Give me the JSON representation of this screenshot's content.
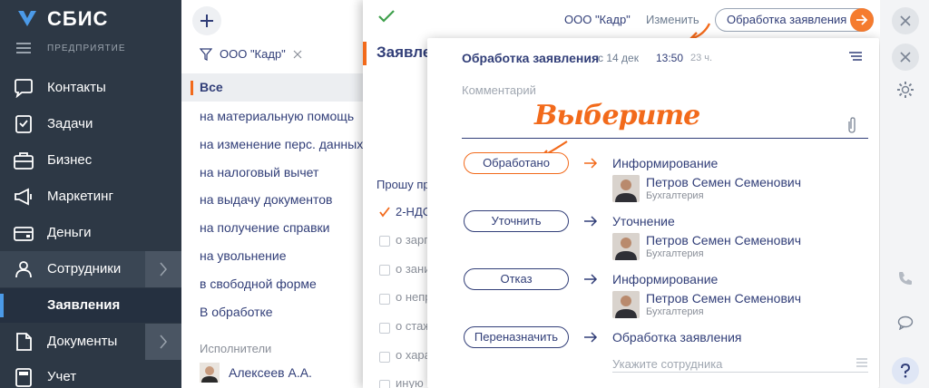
{
  "sidebar": {
    "brand": "СБИС",
    "section": "ПРЕДПРИЯТИЕ",
    "items": [
      {
        "label": "Контакты",
        "icon": "contacts-icon"
      },
      {
        "label": "Задачи",
        "icon": "tasks-icon"
      },
      {
        "label": "Бизнес",
        "icon": "business-icon"
      },
      {
        "label": "Маркетинг",
        "icon": "marketing-icon"
      },
      {
        "label": "Деньги",
        "icon": "money-icon"
      },
      {
        "label": "Сотрудники",
        "icon": "employees-icon"
      },
      {
        "label": "Документы",
        "icon": "documents-icon"
      },
      {
        "label": "Учет",
        "icon": "accounting-icon"
      }
    ],
    "active_sub": "Заявления"
  },
  "filter_panel": {
    "filter_value": "ООО \"Кадр\"",
    "items": [
      "Все",
      "на материальную помощь",
      "на изменение перс. данных",
      "на налоговый вычет",
      "на выдачу документов",
      "на получение справки",
      "на увольнение",
      "в свободной форме",
      "В обработке"
    ],
    "executors_title": "Исполнители",
    "executor": "Алексеев А.А."
  },
  "document": {
    "org": "ООО \"Кадр\"",
    "edit_label": "Изменить",
    "stage_button": "Обработка заявления",
    "title": "Заявле",
    "prompt": "Прошу пр",
    "options": [
      {
        "label": "2-НДС",
        "checked": true
      },
      {
        "label": "о зарп",
        "checked": false
      },
      {
        "label": "о зани",
        "checked": false
      },
      {
        "label": "о непр",
        "checked": false
      },
      {
        "label": "о стаж",
        "checked": false
      },
      {
        "label": "о хара",
        "checked": false
      },
      {
        "label": "иную",
        "checked": false
      }
    ]
  },
  "popup": {
    "title": "Обработка заявления",
    "date": "с 14 дек",
    "time": "13:50",
    "ago": "23 ч.",
    "comment_placeholder": "Комментарий",
    "handwritten": "Выберите",
    "actions": [
      {
        "label": "Обработано",
        "next": "Информирование",
        "person": "Петров Семен Семенович",
        "dept": "Бухгалтерия",
        "highlight": true
      },
      {
        "label": "Уточнить",
        "next": "Уточнение",
        "person": "Петров Семен Семенович",
        "dept": "Бухгалтерия",
        "highlight": false
      },
      {
        "label": "Отказ",
        "next": "Информирование",
        "person": "Петров Семен Семенович",
        "dept": "Бухгалтерия",
        "highlight": false
      },
      {
        "label": "Переназначить",
        "next": "Обработка заявления",
        "person": "",
        "dept": "",
        "highlight": false
      }
    ],
    "employee_placeholder": "Укажите сотрудника"
  },
  "colors": {
    "accent": "#f26a1b",
    "text": "#313e78",
    "sidebar": "#2d3845",
    "highlight_blue": "#4b9ae8"
  }
}
